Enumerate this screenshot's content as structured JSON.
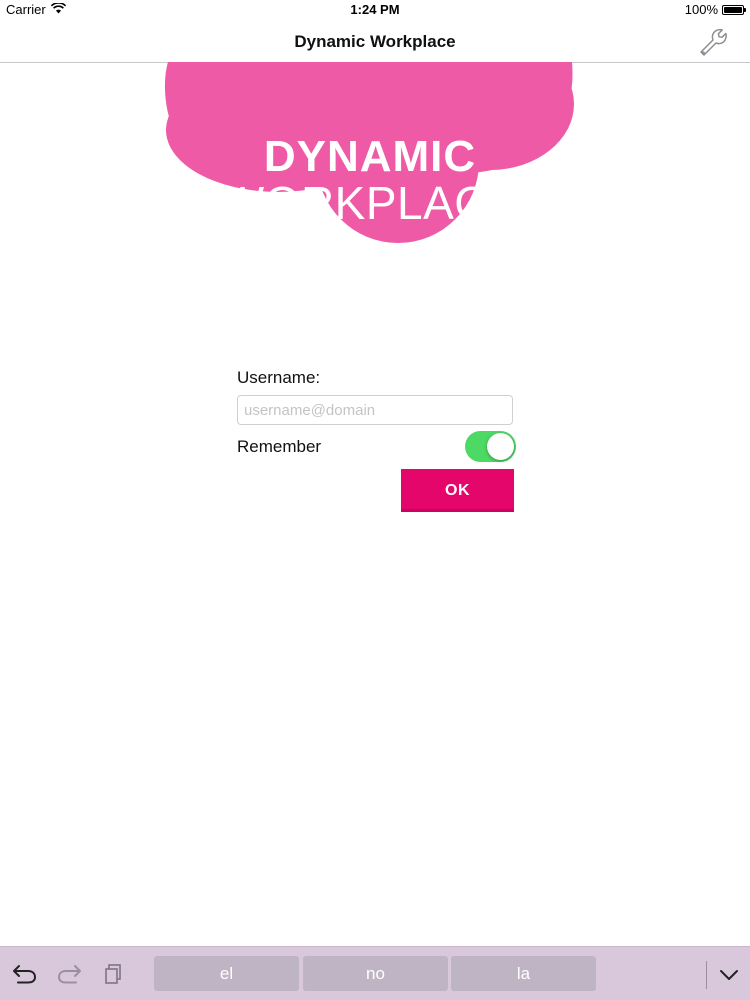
{
  "status_bar": {
    "carrier": "Carrier",
    "time": "1:24 PM",
    "battery": "100%"
  },
  "nav": {
    "title": "Dynamic Workplace",
    "settings_icon": "wrench-icon"
  },
  "logo": {
    "line1": "DYNAMIC",
    "line2": "WORKPLACE",
    "color": "#ef5aa6"
  },
  "form": {
    "username_label": "Username:",
    "username_value": "",
    "username_placeholder": "username@domain",
    "remember_label": "Remember",
    "remember_on": true,
    "ok_label": "OK"
  },
  "colors": {
    "accent": "#e4066b",
    "toggle_on": "#4cd964",
    "keyboard_bar": "#d9c8dc"
  },
  "keyboard": {
    "tools": [
      "undo-icon",
      "redo-icon",
      "paste-icon"
    ],
    "suggestions": [
      "el",
      "no",
      "la"
    ],
    "dismiss_icon": "chevron-down-icon"
  }
}
